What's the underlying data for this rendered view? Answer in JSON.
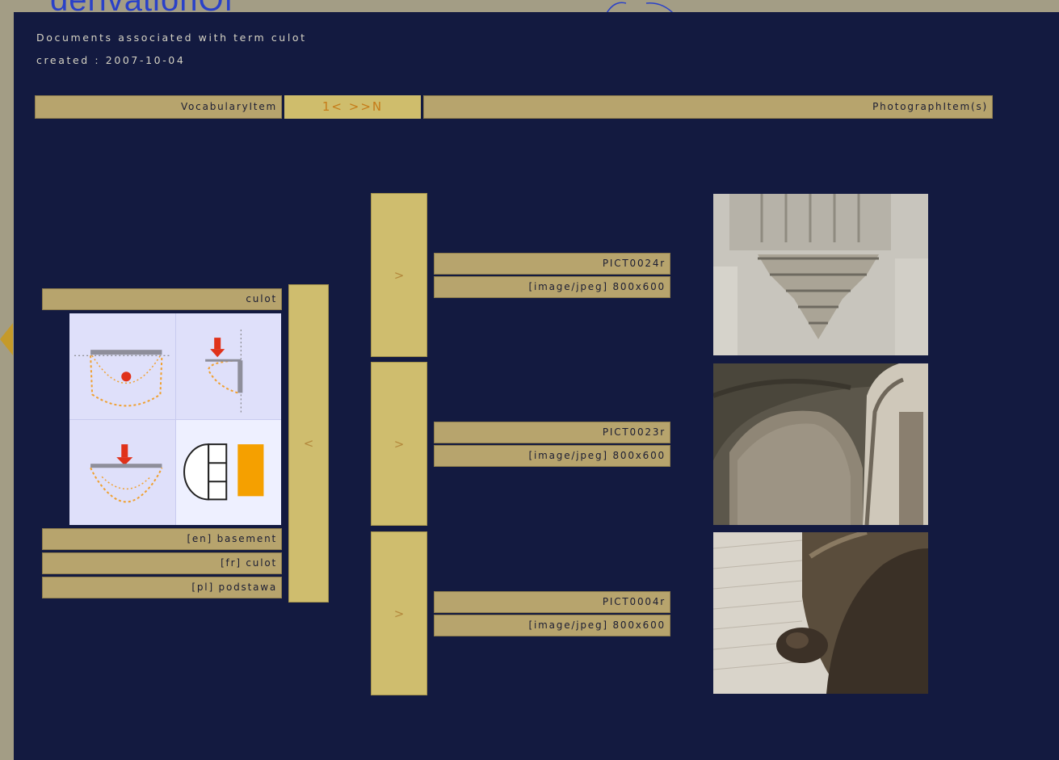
{
  "background": {
    "title_fragment": "derivationOf"
  },
  "header": {
    "line1": "Documents associated with term culot",
    "line2": "created : 2007-10-04"
  },
  "toolbar": {
    "vocabulary_label": "VocabularyItem",
    "nav_label": "1<  >>N",
    "photograph_label": "PhotographItem(s)"
  },
  "vocabulary_item": {
    "term": "culot",
    "back_button": "<",
    "translations": [
      "[en] basement",
      "[fr] culot",
      "[pl] podstawa"
    ]
  },
  "photographs": [
    {
      "button": ">",
      "name": "PICT0024r",
      "meta": "[image/jpeg] 800x600"
    },
    {
      "button": ">",
      "name": "PICT0023r",
      "meta": "[image/jpeg] 800x600"
    },
    {
      "button": ">",
      "name": "PICT0004r",
      "meta": "[image/jpeg] 800x600"
    }
  ],
  "colors": {
    "panel": "#131a40",
    "tan": "#b7a46d",
    "button_gold": "#cfbd6e",
    "accent_orange": "#f5a000",
    "accent_red": "#e0321a"
  }
}
